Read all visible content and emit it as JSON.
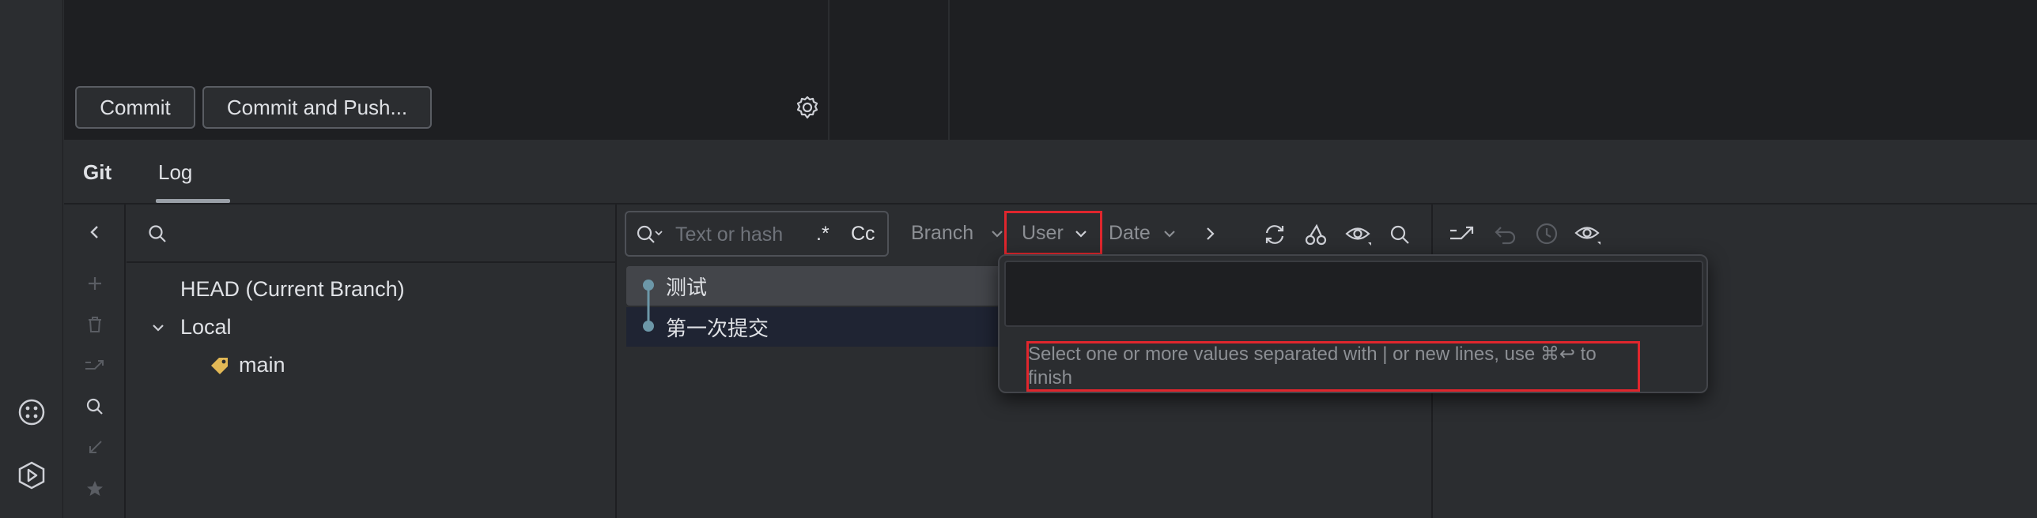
{
  "commit_area": {
    "commit_label": "Commit",
    "commit_push_label": "Commit and Push..."
  },
  "tabs": [
    {
      "label": "Git",
      "active": false
    },
    {
      "label": "Log",
      "active": true
    }
  ],
  "branch_tree": {
    "search_placeholder": "",
    "head": "HEAD (Current Branch)",
    "local": "Local",
    "branches": [
      "main"
    ]
  },
  "log_toolbar": {
    "search_placeholder": "Text or hash",
    "regex_label": ".*",
    "case_label": "Cc",
    "filters": {
      "branch": "Branch",
      "user": "User",
      "date": "Date"
    }
  },
  "commits": [
    {
      "message": "测试",
      "selected": true
    },
    {
      "message": "第一次提交",
      "selected": false
    }
  ],
  "user_filter_popup": {
    "input_value": "",
    "hint": "Select one or more values separated with | or new lines, use ⌘↩ to finish"
  },
  "colors": {
    "accent_red": "#e0262d",
    "graph_node": "#6c97a8",
    "tag_yellow": "#e2b856"
  }
}
